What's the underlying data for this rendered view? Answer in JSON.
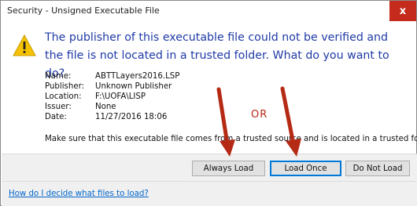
{
  "window": {
    "title": "Security - Unsigned Executable File",
    "close_glyph": "x"
  },
  "icons": {
    "warning": "warning-triangle-icon",
    "close": "close-icon"
  },
  "message": "The publisher of this executable file could not be verified and the file is not located in a trusted folder. What do you want to do?",
  "details": [
    {
      "label": "Name:",
      "value": "ABTTLayers2016.LSP"
    },
    {
      "label": "Publisher:",
      "value": "Unknown Publisher"
    },
    {
      "label": "Location:",
      "value": "F:\\UOFA\\LISP"
    },
    {
      "label": "Issuer:",
      "value": "None"
    },
    {
      "label": "Date:",
      "value": "11/27/2016  18:06"
    }
  ],
  "note": "Make sure that this executable file comes from a trusted source and is located in a trusted folder.",
  "buttons": {
    "always_load": "Always Load",
    "load_once": "Load Once",
    "do_not_load": "Do Not Load"
  },
  "help_link": "How do I decide what files to load?",
  "annotation": {
    "or_text": "OR",
    "color": "#b52a15"
  },
  "colors": {
    "message": "#1f3aa6",
    "close_button": "#c42b1c",
    "link": "#0066cc",
    "button_bar": "#f0f0f0"
  }
}
